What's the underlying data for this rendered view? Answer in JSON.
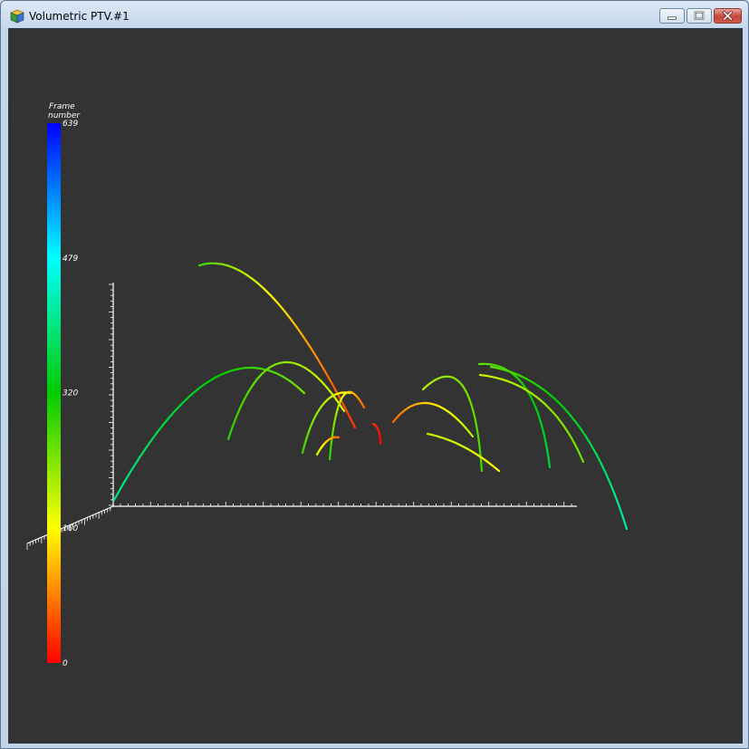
{
  "window": {
    "title": "Volumetric PTV.#1",
    "app_icon": "cube-icon",
    "controls": [
      "minimize-icon",
      "maximize-icon",
      "close-icon"
    ]
  },
  "colorbar": {
    "title_line1": "Frame",
    "title_line2": "number",
    "ticks": [
      "639",
      "479",
      "320",
      "160",
      "0"
    ],
    "tick_values": [
      639,
      479,
      320,
      160,
      0
    ],
    "range": [
      0,
      639
    ],
    "colormap": [
      "#ff0000",
      "#ffff00",
      "#00cc00",
      "#00ffff",
      "#0000ff"
    ]
  },
  "colors": {
    "background": "#333333",
    "axes": "#ffffff"
  }
}
